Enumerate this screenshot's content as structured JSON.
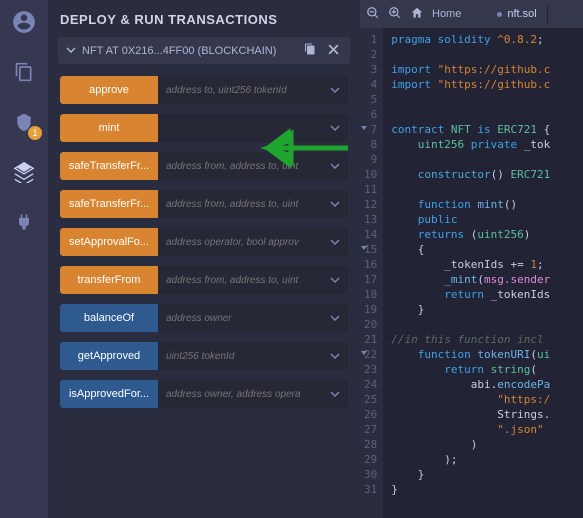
{
  "iconbar": {
    "badge": "1"
  },
  "panel": {
    "title": "DEPLOY & RUN TRANSACTIONS",
    "contract_label": "NFT AT 0X216...4FF00 (BLOCKCHAIN)"
  },
  "functions": [
    {
      "name": "approve",
      "placeholder": "address to, uint256 tokenId",
      "kind": "orange"
    },
    {
      "name": "mint",
      "placeholder": "",
      "kind": "orange"
    },
    {
      "name": "safeTransferFr...",
      "placeholder": "address from, address to, uint",
      "kind": "orange"
    },
    {
      "name": "safeTransferFr...",
      "placeholder": "address from, address to, uint",
      "kind": "orange"
    },
    {
      "name": "setApprovalFo...",
      "placeholder": "address operator, bool approv",
      "kind": "orange"
    },
    {
      "name": "transferFrom",
      "placeholder": "address from, address to, uint",
      "kind": "orange"
    },
    {
      "name": "balanceOf",
      "placeholder": "address owner",
      "kind": "blue"
    },
    {
      "name": "getApproved",
      "placeholder": "uint256 tokenId",
      "kind": "blue"
    },
    {
      "name": "isApprovedFor...",
      "placeholder": "address owner, address opera",
      "kind": "blue"
    }
  ],
  "editor": {
    "home_label": "Home",
    "tab_label": "nft.sol"
  },
  "code": {
    "lines": 31,
    "src": [
      "<span class='kw'>pragma</span> <span class='kw'>solidity</span> <span class='str'>^0.8.2</span>;",
      "",
      "<span class='kw'>import</span> <span class='str'>\"https://github.c</span>",
      "<span class='kw'>import</span> <span class='str'>\"https://github.c</span>",
      "",
      "",
      "<span class='kw'>contract</span> <span class='type'>NFT</span> <span class='kw'>is</span> <span class='type'>ERC721</span> {",
      "    <span class='type'>uint256</span> <span class='kw'>private</span> <span class='id'>_tok</span>",
      "",
      "    <span class='kw2'>constructor</span>() <span class='type'>ERC721</span>",
      "",
      "    <span class='kw'>function</span> <span class='fn'>mint</span>()",
      "    <span class='kw'>public</span>",
      "    <span class='kw'>returns</span> (<span class='type'>uint256</span>)",
      "    {",
      "        <span class='id'>_tokenIds</span> += <span class='str'>1</span>;",
      "        <span class='fn'>_mint</span>(<span class='pink'>msg.sender</span>",
      "        <span class='kw'>return</span> <span class='id'>_tokenIds</span>",
      "    }",
      "",
      "<span class='com'>//in this function incl</span>",
      "    <span class='kw'>function</span> <span class='fn'>tokenURI</span>(<span class='type'>ui</span>",
      "        <span class='kw'>return</span> <span class='type'>string</span>(",
      "            <span class='id'>abi</span>.<span class='fn'>encodePa</span>",
      "                <span class='str'>\"https:/</span>",
      "                <span class='id'>Strings</span>.",
      "                <span class='str'>\".json\"</span>",
      "            )",
      "        );",
      "    }",
      "}"
    ]
  }
}
